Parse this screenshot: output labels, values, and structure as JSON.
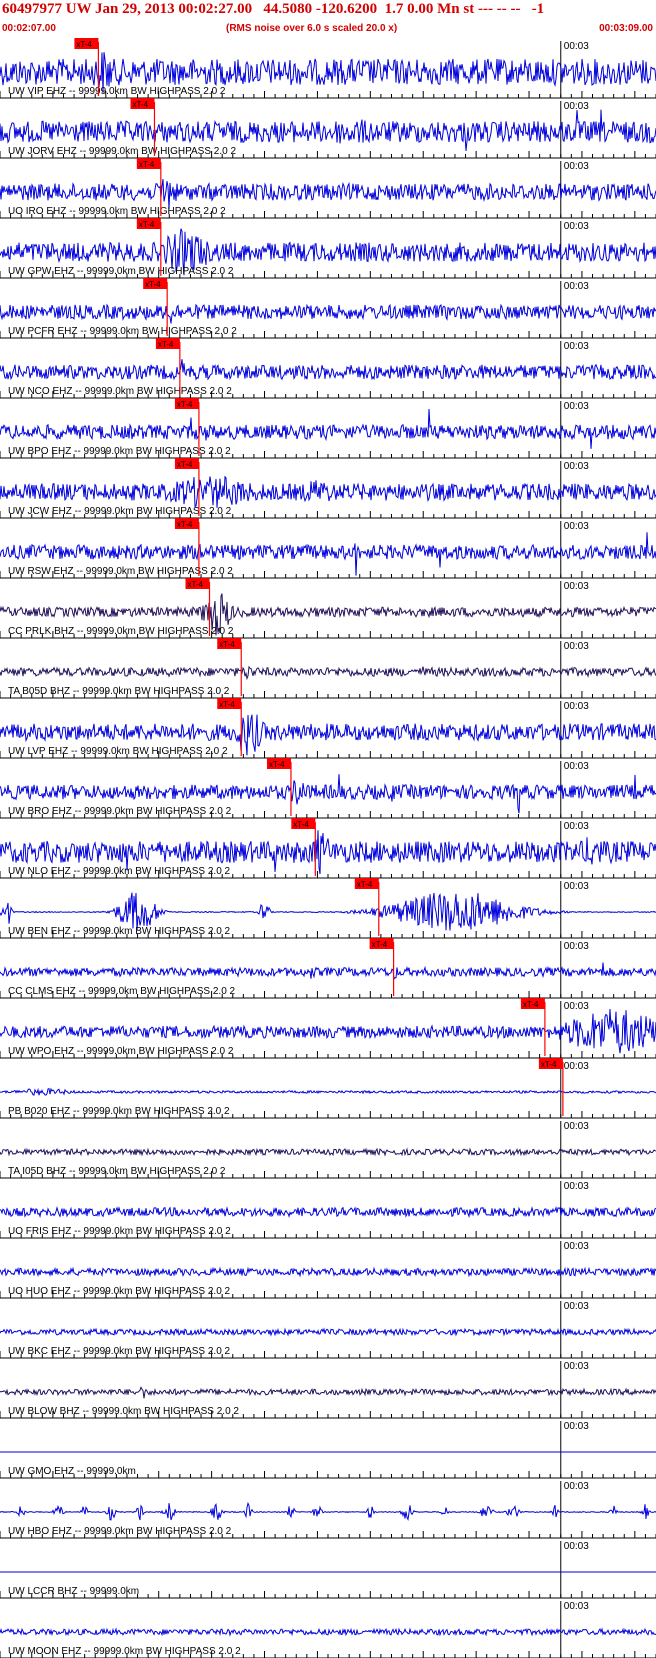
{
  "header": {
    "title": "60497977 UW Jan 29, 2013 00:02:27.00   44.5080 -120.6200  1.7 0.00 Mn st --- -- --   -1",
    "start_time": "00:02:07.00",
    "note": "(RMS noise over 6.0 s scaled 20.0 x)",
    "end_time": "00:03:09.00"
  },
  "colors": {
    "header_red": "#d40000",
    "trace_blue": "#0000dd",
    "trace_dark": "#22105a",
    "pick_red": "#ff0000",
    "grid": "#000000"
  },
  "chart_data": {
    "type": "seismogram",
    "x_unit": "s after 00:02:07.00",
    "xlim": [
      0,
      62
    ],
    "minute_tick_label": "00:03",
    "minute_tick_at_s": 53,
    "pick_label": "xT-4",
    "traces": [
      {
        "label": "UW VIP EHZ -- 99999.0km BW  HIGHPASS  2.0  2",
        "pick_s": 9.3,
        "color": "#0000dd",
        "amp": 0.55,
        "style": "normal",
        "bursts": [
          [
            9.8,
            1.2,
            1.0
          ],
          [
            56.5,
            0.6,
            0.35
          ]
        ],
        "spikes": []
      },
      {
        "label": "UW JORV EHZ -- 99999.0km BW  HIGHPASS  2.0  2",
        "pick_s": 14.6,
        "color": "#0000dd",
        "amp": 0.45,
        "style": "normal",
        "bursts": [
          [
            33,
            5,
            0.55
          ],
          [
            15.2,
            0.8,
            0.4
          ]
        ],
        "spikes": [
          44,
          54.5,
          56.8
        ]
      },
      {
        "label": "UO IRO EHZ -- 99999.0km BW  HIGHPASS  2.0  2",
        "pick_s": 15.2,
        "color": "#0000dd",
        "amp": 0.35,
        "style": "normal",
        "bursts": [
          [
            15.8,
            0.9,
            0.9
          ]
        ],
        "spikes": []
      },
      {
        "label": "UW GPW EHZ -- 99999.0km BW  HIGHPASS  2.0  2",
        "pick_s": 15.2,
        "color": "#0000dd",
        "amp": 0.4,
        "style": "normal",
        "bursts": [
          [
            17.5,
            2.5,
            1.0
          ]
        ],
        "spikes": []
      },
      {
        "label": "UW PCFR EHZ -- 99999.0km BW  HIGHPASS  2.0  2",
        "pick_s": 15.8,
        "color": "#0000dd",
        "amp": 0.3,
        "style": "normal",
        "bursts": [
          [
            16.2,
            1.0,
            0.55
          ]
        ],
        "spikes": []
      },
      {
        "label": "UW NCO EHZ -- 99999.0km BW  HIGHPASS  2.0  2",
        "pick_s": 17.0,
        "color": "#0000dd",
        "amp": 0.3,
        "style": "normal",
        "bursts": [
          [
            17.3,
            0.7,
            0.55
          ]
        ],
        "spikes": []
      },
      {
        "label": "UW BPO EHZ -- 99999.0km BW  HIGHPASS  2.0  2",
        "pick_s": 18.8,
        "color": "#0000dd",
        "amp": 0.3,
        "style": "normal",
        "bursts": [],
        "spikes": [
          18.0,
          19.5,
          40.5,
          51.5,
          55.8
        ]
      },
      {
        "label": "UW JCW EHZ -- 99999.0km BW  HIGHPASS  2.0  2",
        "pick_s": 18.8,
        "color": "#0000dd",
        "amp": 0.35,
        "style": "normal",
        "bursts": [
          [
            20,
            5,
            0.7
          ],
          [
            30,
            2,
            0.55
          ]
        ],
        "spikes": []
      },
      {
        "label": "UW RSW EHZ -- 99999.0km BW  HIGHPASS  2.0  2",
        "pick_s": 18.8,
        "color": "#0000dd",
        "amp": 0.3,
        "style": "normal",
        "bursts": [
          [
            19.2,
            0.6,
            0.5
          ]
        ],
        "spikes": [
          33.6,
          41.6,
          44.1,
          61.2
        ]
      },
      {
        "label": "CC PRLK BHZ -- 99999.0km BW  HIGHPASS  2.0  2",
        "pick_s": 19.8,
        "color": "#22105a",
        "amp": 0.2,
        "style": "normal",
        "bursts": [
          [
            20.5,
            1.4,
            1.0
          ]
        ],
        "spikes": []
      },
      {
        "label": "TA B05D BHZ -- 99999.0km BW  HIGHPASS  2.0  2",
        "pick_s": 22.8,
        "color": "#22105a",
        "amp": 0.18,
        "style": "normal",
        "bursts": [
          [
            23.5,
            0.7,
            0.35
          ],
          [
            40,
            0.5,
            0.25
          ],
          [
            50,
            0.4,
            0.18
          ]
        ],
        "spikes": []
      },
      {
        "label": "UW LVP EHZ -- 99999.0km BW  HIGHPASS  2.0  2",
        "pick_s": 22.8,
        "color": "#0000dd",
        "amp": 0.35,
        "style": "normal",
        "bursts": [
          [
            23.5,
            1.5,
            1.0
          ]
        ],
        "spikes": []
      },
      {
        "label": "UW BRO EHZ -- 99999.0km BW  HIGHPASS  2.0  2",
        "pick_s": 27.5,
        "color": "#0000dd",
        "amp": 0.3,
        "style": "normal",
        "bursts": [
          [
            28.2,
            0.8,
            0.7
          ]
        ],
        "spikes": [
          19,
          32,
          37,
          45,
          49,
          60
        ]
      },
      {
        "label": "UW NLO EHZ -- 99999.0km BW  HIGHPASS  2.0  2",
        "pick_s": 29.8,
        "color": "#0000dd",
        "amp": 0.45,
        "style": "normal",
        "bursts": [
          [
            30.3,
            1.0,
            1.0
          ],
          [
            56,
            1.5,
            0.7
          ]
        ],
        "spikes": [
          12,
          26,
          62.5
        ]
      },
      {
        "label": "UW BEN EHZ -- 99999.0km BW  HIGHPASS  2.0  2",
        "pick_s": 35.8,
        "color": "#0000dd",
        "amp": 0.02,
        "style": "gated",
        "bursts": [
          [
            0.6,
            0.4,
            0.75
          ],
          [
            13,
            1.8,
            0.9
          ],
          [
            25,
            0.4,
            0.6
          ],
          [
            43,
            6,
            0.9
          ],
          [
            63.8,
            0.5,
            0.75
          ]
        ],
        "spikes": []
      },
      {
        "label": "CC CLMS EHZ -- 99999.0km BW  HIGHPASS  2.0  2",
        "pick_s": 37.2,
        "color": "#0000dd",
        "amp": 0.18,
        "style": "normal",
        "bursts": [
          [
            37.2,
            0.5,
            0.35
          ],
          [
            29.5,
            0.3,
            0.35
          ]
        ],
        "spikes": [
          57
        ]
      },
      {
        "label": "UW WPO EHZ -- 99999.0km BW  HIGHPASS  2.0  2",
        "pick_s": 51.5,
        "color": "#0000dd",
        "amp": 0.25,
        "style": "normal",
        "bursts": [
          [
            58,
            5,
            1.0
          ]
        ],
        "spikes": []
      },
      {
        "label": "PB B020 EHZ -- 99999.0km BW  HIGHPASS  2.0  2",
        "pick_s": 53.2,
        "color": "#0000dd",
        "amp": 0.05,
        "style": "normal",
        "bursts": [
          [
            4,
            3,
            0.15
          ]
        ],
        "spikes": []
      },
      {
        "label": "TA I05D BHZ -- 99999.0km BW  HIGHPASS  2.0  2",
        "pick_s": null,
        "color": "#22105a",
        "amp": 0.12,
        "style": "normal",
        "bursts": [],
        "spikes": []
      },
      {
        "label": "UO FRIS EHZ -- 99999.0km BW  HIGHPASS  2.0  2",
        "pick_s": null,
        "color": "#0000dd",
        "amp": 0.18,
        "style": "normal",
        "bursts": [],
        "spikes": []
      },
      {
        "label": "UO HUO EHZ -- 99999.0km BW  HIGHPASS  2.0  2",
        "pick_s": null,
        "color": "#0000dd",
        "amp": 0.15,
        "style": "normal",
        "bursts": [],
        "spikes": []
      },
      {
        "label": "UW BKC EHZ -- 99999.0km BW  HIGHPASS  2.0  2",
        "pick_s": null,
        "color": "#0000dd",
        "amp": 0.12,
        "style": "normal",
        "bursts": [],
        "spikes": []
      },
      {
        "label": "UW BLOW BHZ -- 99999.0km BW  HIGHPASS  2.0  2",
        "pick_s": null,
        "color": "#22105a",
        "amp": 0.12,
        "style": "normal",
        "bursts": [
          [
            13.5,
            0.2,
            0.5
          ]
        ],
        "spikes": []
      },
      {
        "label": "UW GMO EHZ -- 99999.0km",
        "pick_s": null,
        "color": "#0000dd",
        "amp": 0,
        "style": "flat",
        "bursts": [],
        "spikes": []
      },
      {
        "label": "UW HBO EHZ -- 99999.0km BW  HIGHPASS  2.0  2",
        "pick_s": null,
        "color": "#0000dd",
        "amp": 0.02,
        "style": "gated",
        "bursts": [
          [
            2,
            0.3,
            0.3
          ],
          [
            5.5,
            0.4,
            0.4
          ],
          [
            8,
            0.3,
            0.3
          ],
          [
            10.5,
            0.4,
            0.35
          ],
          [
            13.2,
            0.3,
            0.4
          ],
          [
            16,
            0.5,
            0.4
          ],
          [
            20.5,
            0.5,
            0.35
          ],
          [
            23.5,
            0.3,
            0.4
          ],
          [
            27.5,
            0.3,
            0.35
          ],
          [
            30,
            0.4,
            0.3
          ],
          [
            35,
            0.3,
            0.3
          ],
          [
            38.5,
            0.5,
            0.4
          ],
          [
            42,
            0.3,
            0.3
          ],
          [
            46,
            0.5,
            0.4
          ],
          [
            48.5,
            0.5,
            0.35
          ],
          [
            52.5,
            0.3,
            0.35
          ],
          [
            58,
            0.3,
            0.3
          ],
          [
            61,
            0.3,
            0.35
          ]
        ],
        "spikes": []
      },
      {
        "label": "UW LCCR BHZ -- 99999.0km",
        "pick_s": null,
        "color": "#0000dd",
        "amp": 0,
        "style": "flat",
        "bursts": [],
        "spikes": []
      },
      {
        "label": "UW MOON EHZ -- 99999.0km BW  HIGHPASS  2.0  2",
        "pick_s": null,
        "color": "#0000dd",
        "amp": 0.12,
        "style": "normal",
        "bursts": [],
        "spikes": []
      }
    ]
  }
}
